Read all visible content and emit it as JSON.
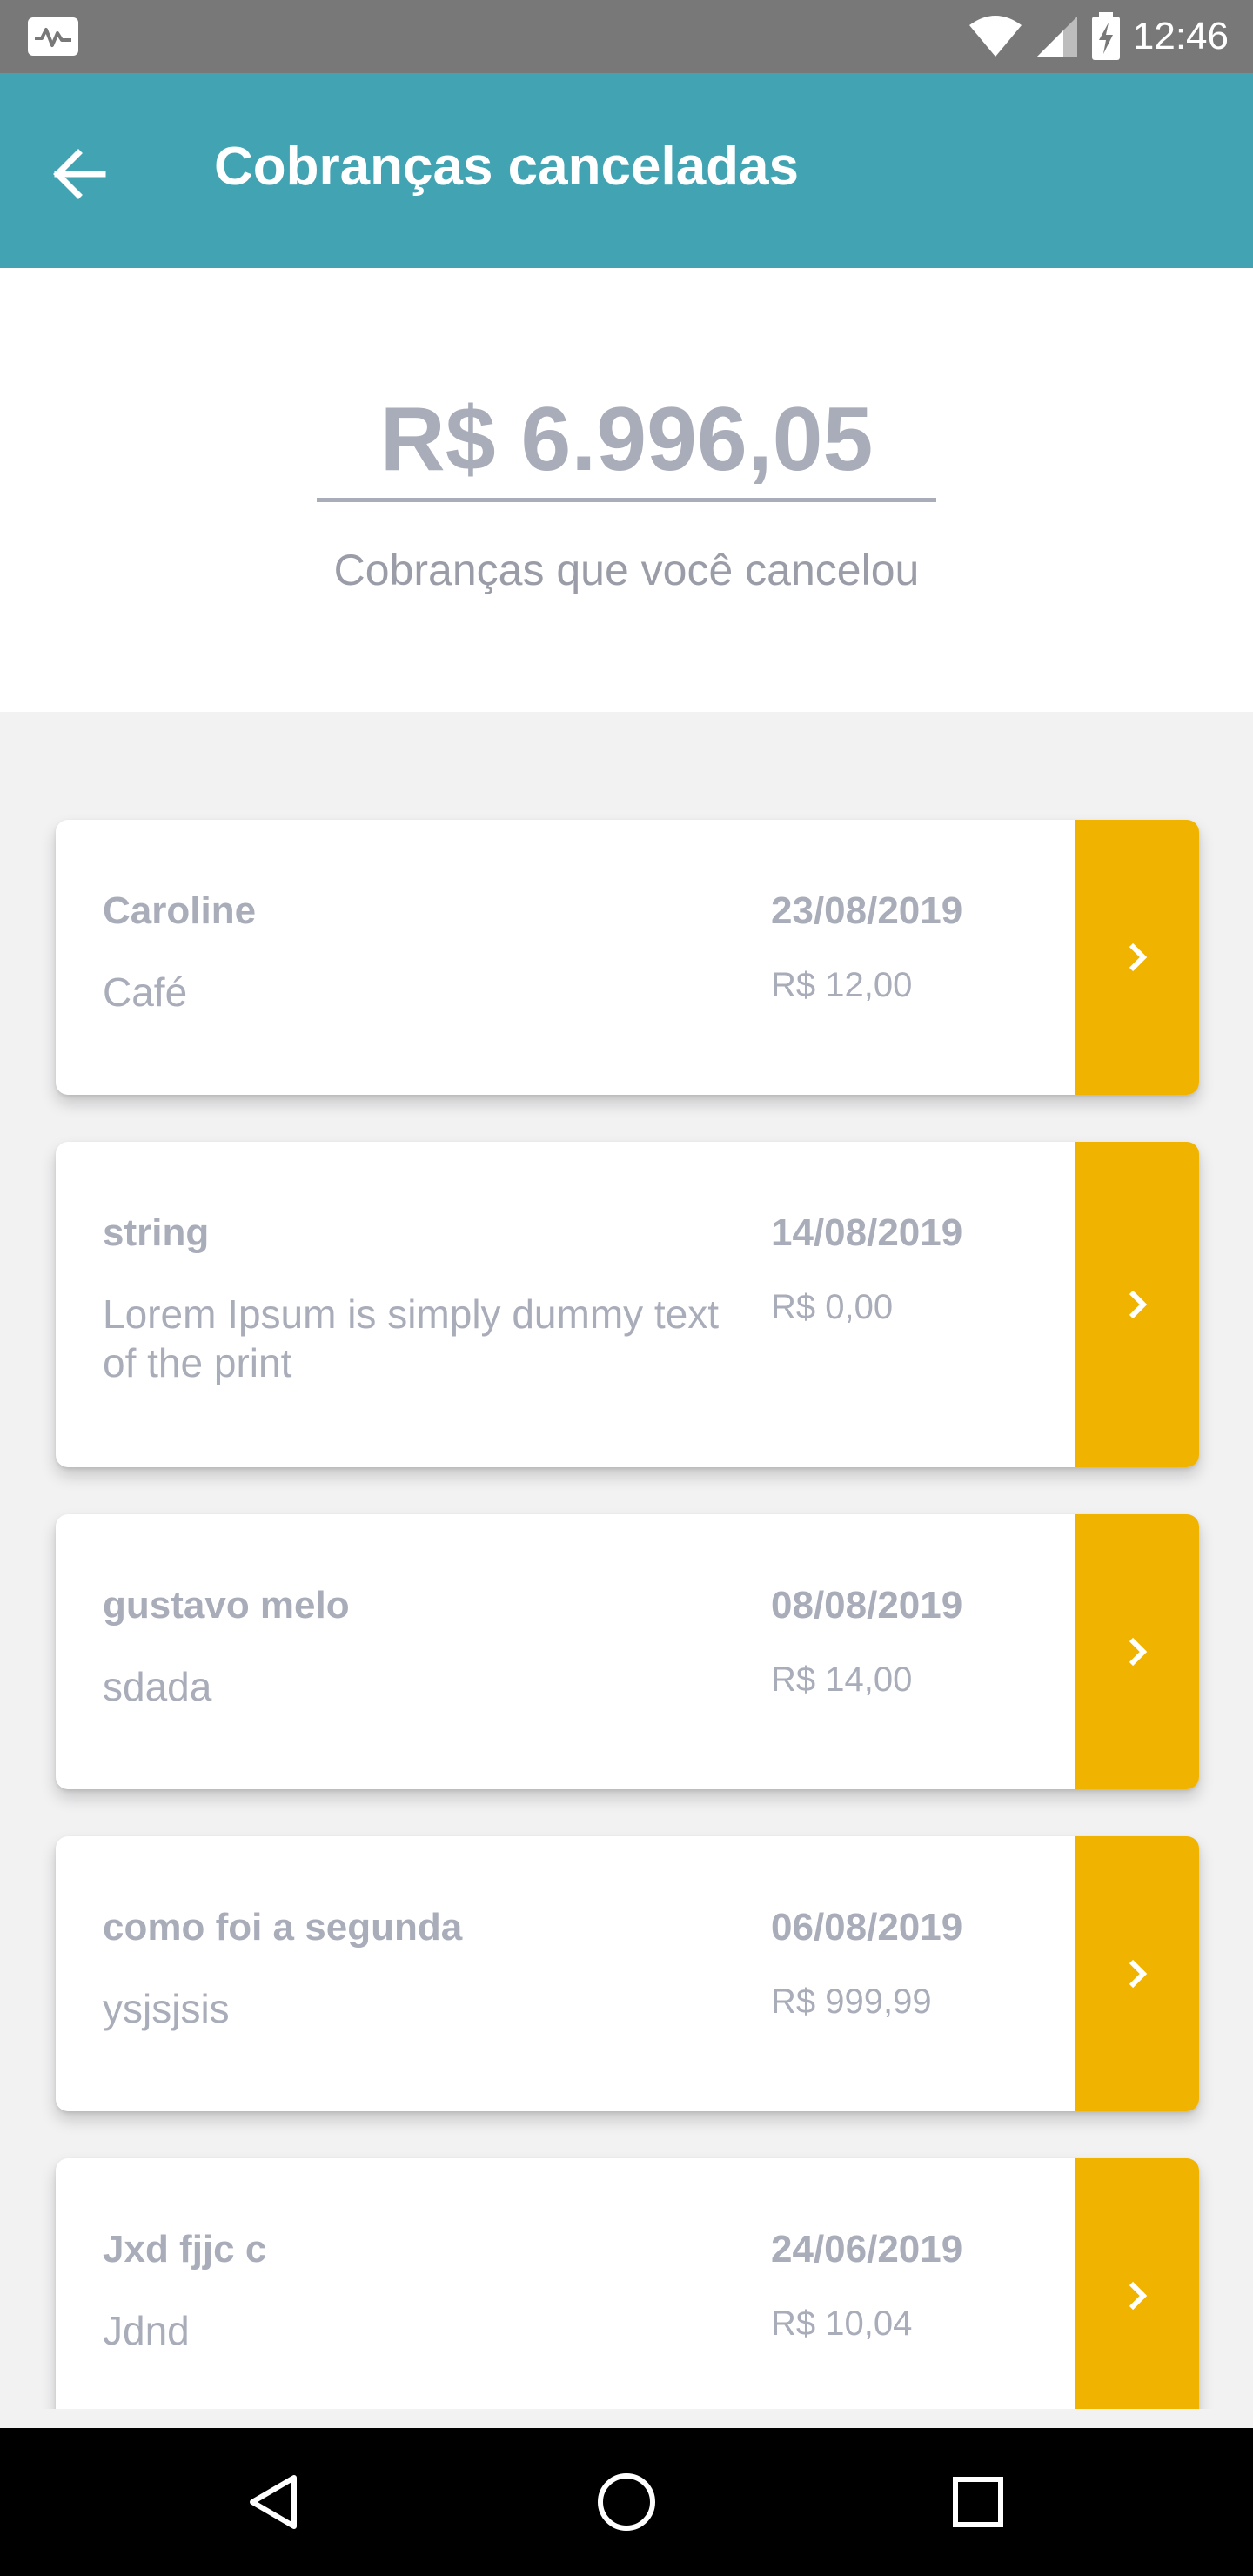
{
  "status_bar": {
    "time": "12:46",
    "icons": [
      "activity-icon",
      "wifi-icon",
      "signal-icon",
      "battery-charging-icon"
    ]
  },
  "app_bar": {
    "back_icon": "arrow-left-icon",
    "title": "Cobranças canceladas"
  },
  "summary": {
    "total": "R$ 6.996,05",
    "caption": "Cobranças que você cancelou"
  },
  "colors": {
    "primary": "#42a4b3",
    "accent": "#f0b400",
    "muted_text": "#a9acb9"
  },
  "charges": [
    {
      "name": "Caroline",
      "description": "Café",
      "date": "23/08/2019",
      "amount": "R$ 12,00"
    },
    {
      "name": "string",
      "description": "Lorem Ipsum is simply dummy text of the print",
      "date": "14/08/2019",
      "amount": "R$ 0,00"
    },
    {
      "name": "gustavo melo",
      "description": "sdada",
      "date": "08/08/2019",
      "amount": "R$ 14,00"
    },
    {
      "name": "como foi a segunda",
      "description": "ysjsjsis",
      "date": "06/08/2019",
      "amount": "R$ 999,99"
    },
    {
      "name": "Jxd fjjc c",
      "description": "Jdnd",
      "date": "24/06/2019",
      "amount": "R$ 10,04"
    }
  ],
  "nav_bar": {
    "icons": [
      "back-triangle-icon",
      "home-circle-icon",
      "recents-square-icon"
    ]
  }
}
